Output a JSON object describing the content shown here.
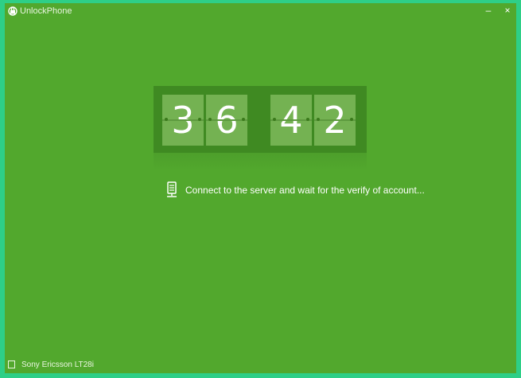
{
  "window": {
    "title": "UnlockPhone",
    "minimize_label": "–",
    "close_label": "×"
  },
  "counter": {
    "digits": [
      "3",
      "6",
      "4",
      "2"
    ]
  },
  "status": {
    "icon": "server-icon",
    "message": "Connect to the server and wait for the verify of account..."
  },
  "device": {
    "icon": "phone-icon",
    "name": "Sony Ericsson LT28i"
  },
  "colors": {
    "window_bg": "#52a82d",
    "frame_border": "#2ecf87",
    "counter_bg": "#3f8a22",
    "digit_tile": "#74b252"
  }
}
